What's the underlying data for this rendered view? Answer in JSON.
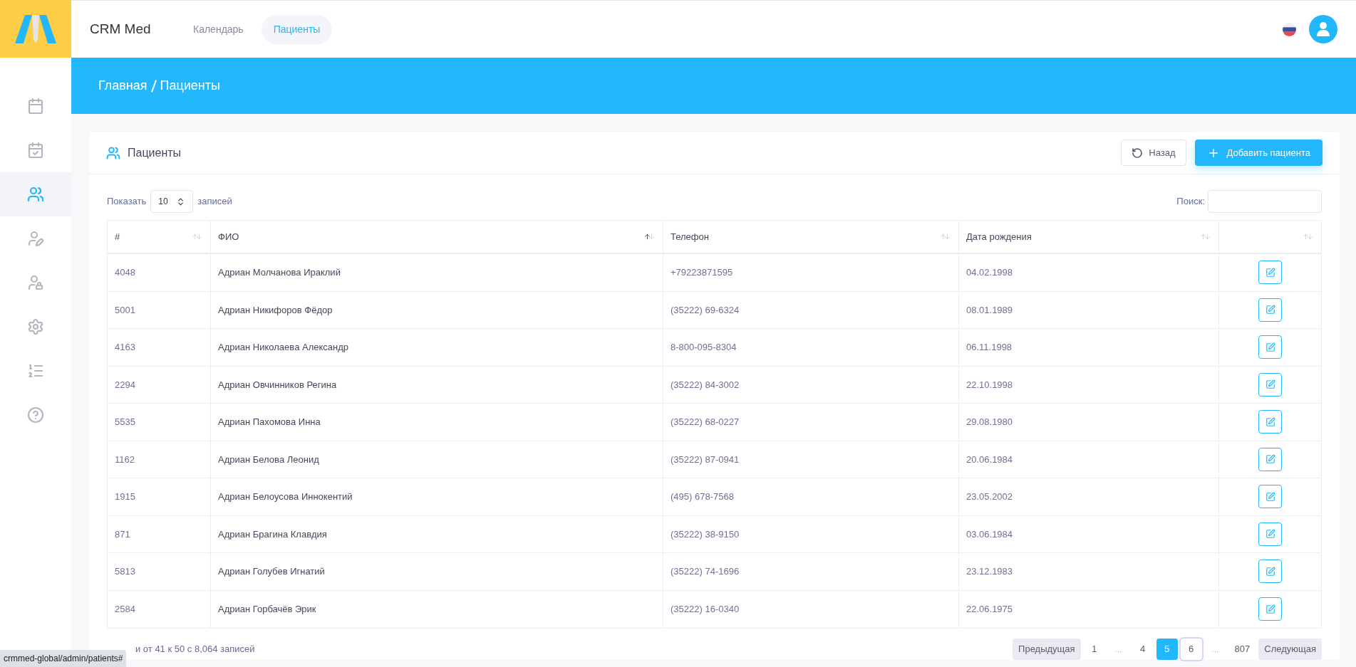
{
  "brand": "CRM Med",
  "nav": [
    {
      "label": "Календарь",
      "selected": false
    },
    {
      "label": "Пациенты",
      "selected": true
    }
  ],
  "sidebar": {
    "items": [
      {
        "kind": "calendar",
        "selected": false
      },
      {
        "kind": "calendar-check",
        "selected": false
      },
      {
        "kind": "users",
        "selected": true
      },
      {
        "kind": "user-edit",
        "selected": false
      },
      {
        "kind": "user-lock",
        "selected": false
      },
      {
        "kind": "settings",
        "selected": false
      },
      {
        "kind": "list",
        "selected": false
      },
      {
        "kind": "help",
        "selected": false
      }
    ]
  },
  "breadcrumb": [
    "Главная",
    "Пациенты"
  ],
  "card": {
    "title": "Пациенты",
    "back_button": "Назад",
    "add_button": "Добавить пациента"
  },
  "length": {
    "label_before": "Показать",
    "value": "10",
    "label_after": "записей"
  },
  "search": {
    "label": "Поиск:"
  },
  "table": {
    "columns": [
      {
        "label": "#",
        "sorted": false
      },
      {
        "label": "ФИО",
        "sorted": true
      },
      {
        "label": "Телефон",
        "sorted": false
      },
      {
        "label": "Дата рождения",
        "sorted": false
      },
      {
        "sorted": false
      }
    ],
    "rows": [
      {
        "id": "4048",
        "name": "Адриан Молчановa Ираклий",
        "phone": "+79223871595",
        "birth": "04.02.1998"
      },
      {
        "id": "5001",
        "name": "Адриан Никифоров Фёдор",
        "phone": "(35222) 69-6324",
        "birth": "08.01.1989"
      },
      {
        "id": "4163",
        "name": "Адриан Николаевa Александр",
        "phone": "8-800-095-8304",
        "birth": "06.11.1998"
      },
      {
        "id": "2294",
        "name": "Адриан Овчинников Регина",
        "phone": "(35222) 84-3002",
        "birth": "22.10.1998"
      },
      {
        "id": "5535",
        "name": "Адриан Пахомовa Инна",
        "phone": "(35222) 68-0227",
        "birth": "29.08.1980"
      },
      {
        "id": "1162",
        "name": "Адриан Беловa Леонид",
        "phone": "(35222) 87-0941",
        "birth": "20.06.1984"
      },
      {
        "id": "1915",
        "name": "Адриан Белоусовa Иннокентий",
        "phone": "(495) 678-7568",
        "birth": "23.05.2002"
      },
      {
        "id": "871",
        "name": "Адриан Брагинa Клавдия",
        "phone": "(35222) 38-9150",
        "birth": "03.06.1984"
      },
      {
        "id": "5813",
        "name": "Адриан Голубев Игнатий",
        "phone": "(35222) 74-1696",
        "birth": "23.12.1983"
      },
      {
        "id": "2584",
        "name": "Адриан Горбачёв Эрик",
        "phone": "(35222) 16-0340",
        "birth": "22.06.1975"
      }
    ]
  },
  "info": "и от 41 к 50 с 8,064 записей",
  "pagination": [
    {
      "kind": "prev",
      "label": "Предыдущая",
      "selected": false,
      "focused": false
    },
    {
      "kind": "page",
      "label": "1",
      "selected": false,
      "focused": false
    },
    {
      "kind": "ellipsis",
      "label": "…",
      "selected": false,
      "focused": false
    },
    {
      "kind": "page",
      "label": "4",
      "selected": false,
      "focused": false
    },
    {
      "kind": "page",
      "label": "5",
      "selected": true,
      "focused": false
    },
    {
      "kind": "page",
      "label": "6",
      "selected": false,
      "focused": true
    },
    {
      "kind": "ellipsis",
      "label": "…",
      "selected": false,
      "focused": false
    },
    {
      "kind": "page",
      "label": "807",
      "selected": false,
      "focused": false
    },
    {
      "kind": "next",
      "label": "Следующая",
      "selected": false,
      "focused": false
    }
  ],
  "status_bar": {
    "url": "crmmed-global/admin/patients#"
  }
}
